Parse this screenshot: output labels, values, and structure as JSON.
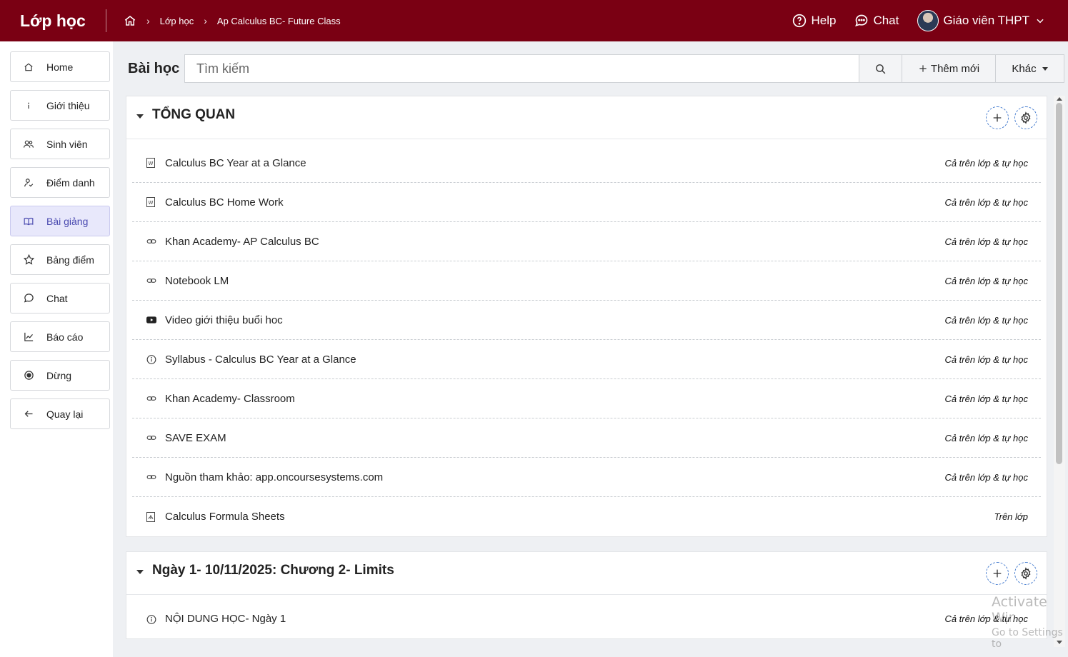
{
  "header": {
    "brand": "Lớp học",
    "breadcrumb": [
      "Lớp học",
      "Ap Calculus BC- Future Class"
    ],
    "help_label": "Help",
    "chat_label": "Chat",
    "user_label": "Giáo viên THPT"
  },
  "sidebar": {
    "items": [
      {
        "label": "Home",
        "icon": "home-icon"
      },
      {
        "label": "Giới thiệu",
        "icon": "info-icon"
      },
      {
        "label": "Sinh viên",
        "icon": "users-icon"
      },
      {
        "label": "Điểm danh",
        "icon": "attendance-icon"
      },
      {
        "label": "Bài giảng",
        "icon": "book-icon",
        "active": true
      },
      {
        "label": "Bảng điểm",
        "icon": "star-icon"
      },
      {
        "label": "Chat",
        "icon": "chat-icon"
      },
      {
        "label": "Báo cáo",
        "icon": "chart-icon"
      },
      {
        "label": "Dừng",
        "icon": "stop-icon"
      },
      {
        "label": "Quay lại",
        "icon": "arrow-left-icon"
      }
    ]
  },
  "toolbar": {
    "label": "Bài học",
    "search_placeholder": "Tìm kiếm",
    "add_label": "Thêm mới",
    "more_label": "Khác"
  },
  "sections": [
    {
      "title": "TỔNG QUAN",
      "rows": [
        {
          "icon": "word-doc-icon",
          "title": "Calculus BC Year at a Glance",
          "mode": "Cả trên lớp & tự học"
        },
        {
          "icon": "word-doc-icon",
          "title": "Calculus BC Home Work",
          "mode": "Cả trên lớp & tự học"
        },
        {
          "icon": "link-icon",
          "title": "Khan Academy- AP Calculus BC",
          "mode": "Cả trên lớp & tự học"
        },
        {
          "icon": "link-icon",
          "title": "Notebook LM",
          "mode": "Cả trên lớp & tự học"
        },
        {
          "icon": "youtube-icon",
          "title": "Video giới thiệu buổi hoc",
          "mode": "Cả trên lớp & tự học"
        },
        {
          "icon": "info-circle-icon",
          "title": "Syllabus - Calculus BC Year at a Glance",
          "mode": "Cả trên lớp & tự học"
        },
        {
          "icon": "link-icon",
          "title": "Khan Academy- Classroom",
          "mode": "Cả trên lớp & tự học"
        },
        {
          "icon": "link-icon",
          "title": "SAVE EXAM",
          "mode": "Cả trên lớp & tự học"
        },
        {
          "icon": "link-icon",
          "title": "Nguồn tham khảo: app.oncoursesystems.com",
          "mode": "Cả trên lớp & tự học"
        },
        {
          "icon": "pdf-icon",
          "title": "Calculus Formula Sheets",
          "mode": "Trên lớp"
        }
      ]
    },
    {
      "title": "Ngày 1- 10/11/2025: Chương 2- Limits",
      "rows": [
        {
          "icon": "info-circle-icon",
          "title": "NỘI DUNG HỌC- Ngày 1",
          "mode": "Cả trên lớp & tự học"
        }
      ]
    }
  ],
  "watermark": {
    "line1": "Activate Wir",
    "line2": "Go to Settings to"
  },
  "colors": {
    "header_bg": "#7a0013",
    "active_bg": "#e8e8fb",
    "active_text": "#4a4ab0"
  }
}
